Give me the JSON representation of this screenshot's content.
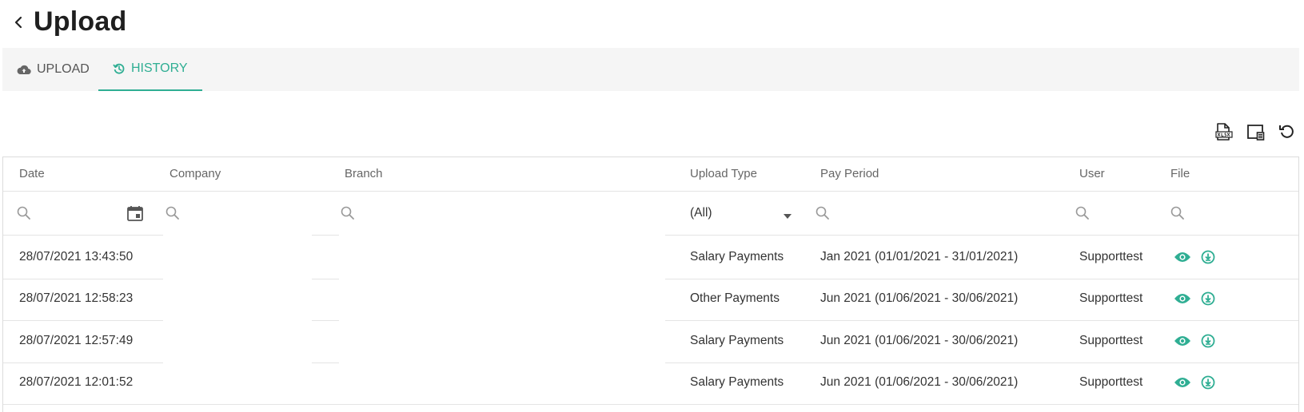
{
  "page": {
    "title": "Upload"
  },
  "tabs": [
    {
      "label": "UPLOAD",
      "icon": "cloud-upload-icon",
      "active": false
    },
    {
      "label": "HISTORY",
      "icon": "history-icon",
      "active": true
    }
  ],
  "toolbar": {
    "icons": [
      "export-xlsx-icon",
      "column-chooser-icon",
      "refresh-icon"
    ]
  },
  "table": {
    "columns": [
      "Date",
      "Company",
      "Branch",
      "Upload Type",
      "Pay Period",
      "User",
      "File"
    ],
    "filters": {
      "upload_type": "(All)"
    },
    "rows": [
      {
        "date": "28/07/2021 13:43:50",
        "company": "",
        "branch": "",
        "upload_type": "Salary Payments",
        "pay_period": "Jan 2021 (01/01/2021 - 31/01/2021)",
        "user": "Supporttest"
      },
      {
        "date": "28/07/2021 12:58:23",
        "company": "",
        "branch": "",
        "upload_type": "Other Payments",
        "pay_period": "Jun 2021 (01/06/2021 - 30/06/2021)",
        "user": "Supporttest"
      },
      {
        "date": "28/07/2021 12:57:49",
        "company": "",
        "branch": "",
        "upload_type": "Salary Payments",
        "pay_period": "Jun 2021 (01/06/2021 - 30/06/2021)",
        "user": "Supporttest"
      },
      {
        "date": "28/07/2021 12:01:52",
        "company": "",
        "branch": "",
        "upload_type": "Salary Payments",
        "pay_period": "Jun 2021 (01/06/2021 - 30/06/2021)",
        "user": "Supporttest"
      }
    ]
  },
  "colors": {
    "accent": "#2fae93",
    "text": "#333333",
    "muted": "#666666",
    "tabbar_bg": "#f5f5f5"
  }
}
